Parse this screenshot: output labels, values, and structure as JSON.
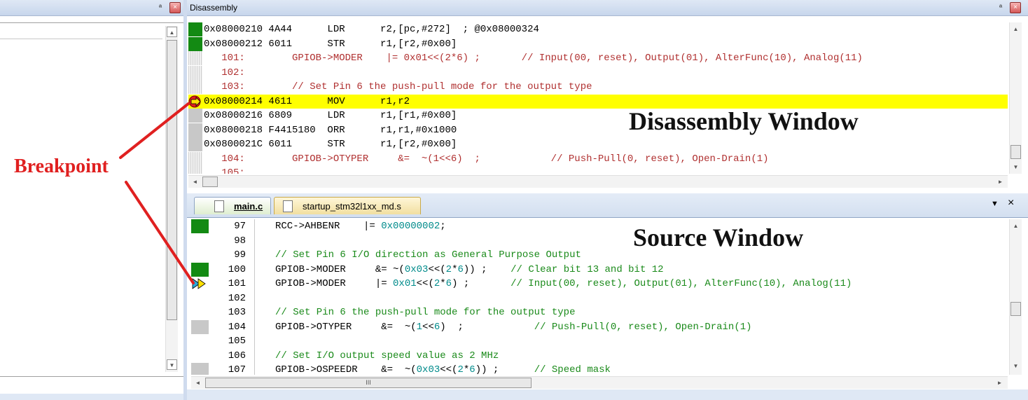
{
  "left_panel": {
    "pin_glyph": "ª",
    "close_glyph": "×"
  },
  "disassembly": {
    "title": "Disassembly",
    "pin_glyph": "ª",
    "close_glyph": "×",
    "lines": [
      {
        "text": "0x08000210 4A44      LDR      r2,[pc,#272]  ; @0x08000324",
        "kind": "asm",
        "gutter": "green"
      },
      {
        "text": "0x08000212 6011      STR      r1,[r2,#0x00]",
        "kind": "asm",
        "gutter": "green"
      },
      {
        "text": "   101:        GPIOB->MODER    |= 0x01<<(2*6) ;       // Input(00, reset), Output(01), AlterFunc(10), Analog(11)",
        "kind": "src",
        "gutter": "hatch"
      },
      {
        "text": "   102:",
        "kind": "src",
        "gutter": "hatch"
      },
      {
        "text": "   103:        // Set Pin 6 the push-pull mode for the output type",
        "kind": "src",
        "gutter": "hatch"
      },
      {
        "text": "0x08000214 4611      MOV      r1,r2",
        "kind": "asm",
        "gutter": "current",
        "highlight": true
      },
      {
        "text": "0x08000216 6809      LDR      r1,[r1,#0x00]",
        "kind": "asm",
        "gutter": "gray"
      },
      {
        "text": "0x08000218 F4415180  ORR      r1,r1,#0x1000",
        "kind": "asm",
        "gutter": "gray"
      },
      {
        "text": "0x0800021C 6011      STR      r1,[r2,#0x00]",
        "kind": "asm",
        "gutter": "gray"
      },
      {
        "text": "   104:        GPIOB->OTYPER     &=  ~(1<<6)  ;            // Push-Pull(0, reset), Open-Drain(1)",
        "kind": "src",
        "gutter": "hatch"
      },
      {
        "text": "   105:",
        "kind": "src",
        "gutter": "hatch"
      }
    ]
  },
  "annotations": {
    "disassembly_window": "Disassembly Window",
    "source_window": "Source Window",
    "breakpoint": "Breakpoint"
  },
  "source": {
    "tabs": [
      {
        "label": "main.c",
        "active": true
      },
      {
        "label": "startup_stm32l1xx_md.s",
        "active": false
      }
    ],
    "menu_glyph": "▼",
    "close_glyph": "×",
    "hscroll_grip": "III",
    "lines": [
      {
        "num": "97",
        "gutter": "green",
        "parts": [
          [
            "RCC->AHBENR    |= ",
            "c-black"
          ],
          [
            "0x00000002",
            "c-teal"
          ],
          [
            ";",
            "c-black"
          ]
        ]
      },
      {
        "num": "98",
        "gutter": "none",
        "parts": []
      },
      {
        "num": "99",
        "gutter": "none",
        "parts": [
          [
            "// Set Pin 6 I/O direction as General Purpose Output",
            "c-green"
          ]
        ]
      },
      {
        "num": "100",
        "gutter": "green",
        "parts": [
          [
            "GPIOB->MODER     &= ~(",
            "c-black"
          ],
          [
            "0x03",
            "c-teal"
          ],
          [
            "<<(",
            "c-black"
          ],
          [
            "2",
            "c-teal"
          ],
          [
            "*",
            "c-black"
          ],
          [
            "6",
            "c-teal"
          ],
          [
            ")) ;    ",
            "c-black"
          ],
          [
            "// Clear bit 13 and bit 12",
            "c-green"
          ]
        ]
      },
      {
        "num": "101",
        "gutter": "bp",
        "parts": [
          [
            "GPIOB->MODER     |= ",
            "c-black"
          ],
          [
            "0x01",
            "c-teal"
          ],
          [
            "<<(",
            "c-black"
          ],
          [
            "2",
            "c-teal"
          ],
          [
            "*",
            "c-black"
          ],
          [
            "6",
            "c-teal"
          ],
          [
            ") ;       ",
            "c-black"
          ],
          [
            "// Input(00, reset), Output(01), AlterFunc(10), Analog(11)",
            "c-green"
          ]
        ]
      },
      {
        "num": "102",
        "gutter": "none",
        "parts": []
      },
      {
        "num": "103",
        "gutter": "none",
        "parts": [
          [
            "// Set Pin 6 the push-pull mode for the output type",
            "c-green"
          ]
        ]
      },
      {
        "num": "104",
        "gutter": "gray",
        "parts": [
          [
            "GPIOB->OTYPER     &=  ~(",
            "c-black"
          ],
          [
            "1",
            "c-teal"
          ],
          [
            "<<",
            "c-black"
          ],
          [
            "6",
            "c-teal"
          ],
          [
            ")  ;            ",
            "c-black"
          ],
          [
            "// Push-Pull(0, reset), Open-Drain(1)",
            "c-green"
          ]
        ]
      },
      {
        "num": "105",
        "gutter": "none",
        "parts": []
      },
      {
        "num": "106",
        "gutter": "none",
        "parts": [
          [
            "// Set I/O output speed value as 2 MHz",
            "c-green"
          ]
        ]
      },
      {
        "num": "107",
        "gutter": "gray",
        "parts": [
          [
            "GPIOB->OSPEEDR    &=  ~(",
            "c-black"
          ],
          [
            "0x03",
            "c-teal"
          ],
          [
            "<<(",
            "c-black"
          ],
          [
            "2",
            "c-teal"
          ],
          [
            "*",
            "c-black"
          ],
          [
            "6",
            "c-teal"
          ],
          [
            ")) ;      ",
            "c-black"
          ],
          [
            "// Speed mask",
            "c-green"
          ]
        ]
      }
    ]
  },
  "colors": {
    "highlight": "#ffff00",
    "green_gutter": "#138a13",
    "annotation_red": "#e02020",
    "titlebar": "#c7d6ec"
  }
}
